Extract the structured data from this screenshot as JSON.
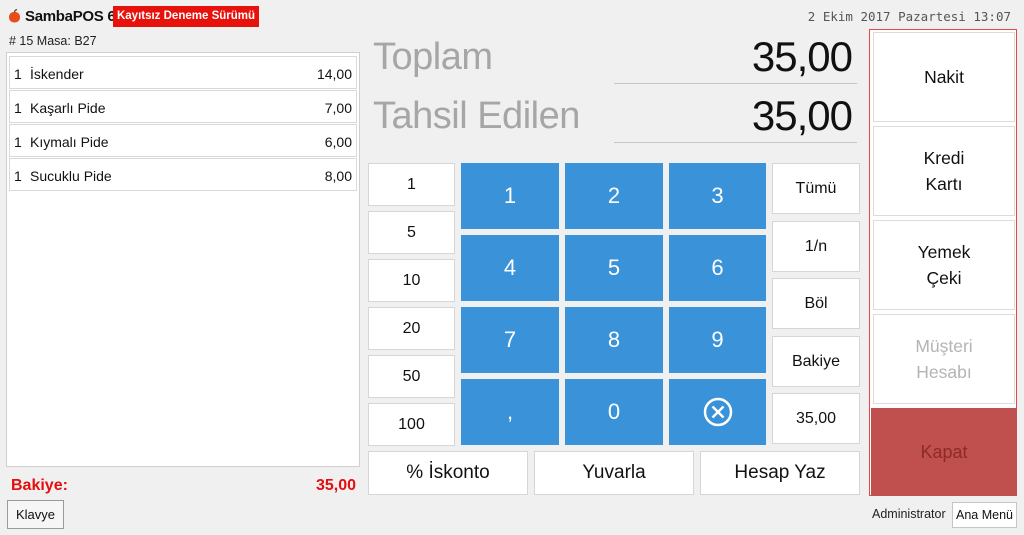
{
  "header": {
    "app_name": "SambaPOS 6",
    "trial_badge": "Kayıtsız Deneme Sürümü",
    "datetime": "2 Ekim 2017 Pazartesi 13:07",
    "ticket_info": "# 15 Masa: B27"
  },
  "order": {
    "items": [
      {
        "qty": "1",
        "name": "İskender",
        "price": "14,00"
      },
      {
        "qty": "1",
        "name": "Kaşarlı Pide",
        "price": "7,00"
      },
      {
        "qty": "1",
        "name": "Kıymalı Pide",
        "price": "6,00"
      },
      {
        "qty": "1",
        "name": "Sucuklu Pide",
        "price": "8,00"
      }
    ],
    "balance_label": "Bakiye:",
    "balance_value": "35,00",
    "keyboard_label": "Klavye"
  },
  "totals": {
    "total_label": "Toplam",
    "total_value": "35,00",
    "collected_label": "Tahsil Edilen",
    "collected_value": "35,00"
  },
  "presets": [
    "1",
    "5",
    "10",
    "20",
    "50",
    "100"
  ],
  "numpad": [
    "1",
    "2",
    "3",
    "4",
    "5",
    "6",
    "7",
    "8",
    "9",
    ",",
    "0"
  ],
  "side_buttons": [
    "Tümü",
    "1/n",
    "Böl",
    "Bakiye",
    "35,00"
  ],
  "bottom_buttons": {
    "discount": "% İskonto",
    "round": "Yuvarla",
    "print_bill": "Hesap Yaz"
  },
  "payment": {
    "cash": "Nakit",
    "credit_card": "Kredi\nKartı",
    "meal_voucher": "Yemek\nÇeki",
    "customer_account": "Müşteri\nHesabı",
    "close": "Kapat"
  },
  "footer": {
    "user": "Administrator",
    "main_menu": "Ana Menü"
  },
  "colors": {
    "accent_blue": "#3a92d8",
    "trial_red": "#e8120c",
    "balance_red": "#e50d0d",
    "close_red": "#c0504d",
    "highlight_border": "#e24a4a"
  }
}
